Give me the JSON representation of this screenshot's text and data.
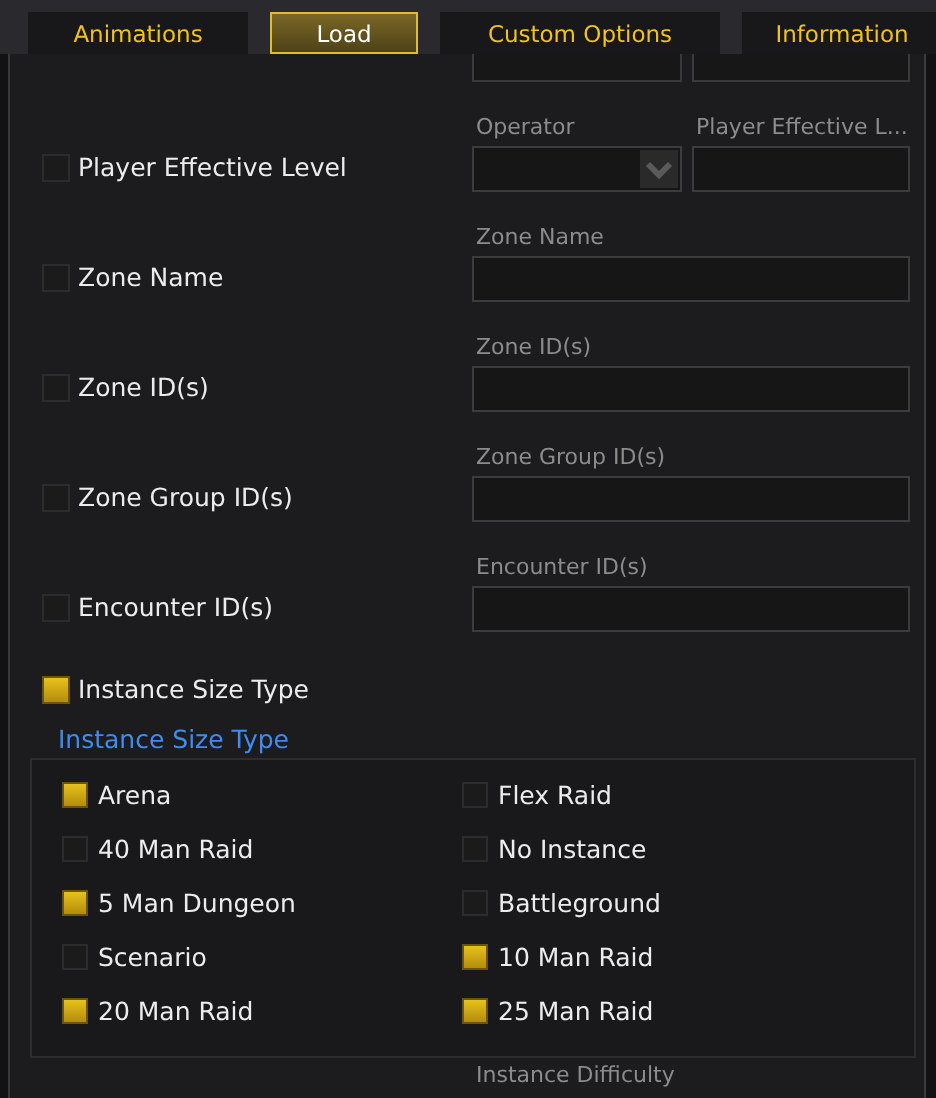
{
  "tabs": [
    {
      "label": "Animations",
      "selected": false
    },
    {
      "label": "Load",
      "selected": true
    },
    {
      "label": "Custom Options",
      "selected": false
    },
    {
      "label": "Information",
      "selected": false
    }
  ],
  "options": [
    {
      "kind": "operator-number",
      "label": "Player Effective Level",
      "checked": false,
      "operator_label": "Operator",
      "value_label": "Player Effective L..."
    },
    {
      "kind": "text",
      "label": "Zone Name",
      "checked": false,
      "field_label": "Zone Name"
    },
    {
      "kind": "text",
      "label": "Zone ID(s)",
      "checked": false,
      "field_label": "Zone ID(s)"
    },
    {
      "kind": "text",
      "label": "Zone Group ID(s)",
      "checked": false,
      "field_label": "Zone Group ID(s)"
    },
    {
      "kind": "text",
      "label": "Encounter ID(s)",
      "checked": false,
      "field_label": "Encounter ID(s)"
    }
  ],
  "instance_size": {
    "label": "Instance Size Type",
    "checked": true,
    "header": "Instance Size Type",
    "items": [
      {
        "label": "Arena",
        "checked": true
      },
      {
        "label": "Flex Raid",
        "checked": false
      },
      {
        "label": "40 Man Raid",
        "checked": false
      },
      {
        "label": "No Instance",
        "checked": false
      },
      {
        "label": "5 Man Dungeon",
        "checked": true
      },
      {
        "label": "Battleground",
        "checked": false
      },
      {
        "label": "Scenario",
        "checked": false
      },
      {
        "label": "10 Man Raid",
        "checked": true
      },
      {
        "label": "20 Man Raid",
        "checked": true
      },
      {
        "label": "25 Man Raid",
        "checked": true
      }
    ]
  },
  "next_section_label": "Instance Difficulty"
}
